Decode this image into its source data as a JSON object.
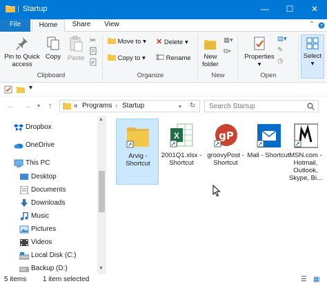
{
  "window": {
    "title": "Startup",
    "minimize_glyph": "—",
    "maximize_glyph": "☐",
    "close_glyph": "✕"
  },
  "tabs": [
    {
      "label": "File"
    },
    {
      "label": "Home"
    },
    {
      "label": "Share"
    },
    {
      "label": "View"
    }
  ],
  "ribbon": {
    "clipboard": {
      "pin_label": "Pin to Quick access",
      "copy_label": "Copy",
      "paste_label": "Paste",
      "group_label": "Clipboard"
    },
    "organize": {
      "move_to_label": "Move to",
      "copy_to_label": "Copy to",
      "delete_label": "Delete",
      "rename_label": "Rename",
      "group_label": "Organize"
    },
    "new": {
      "new_folder_label": "New folder",
      "group_label": "New"
    },
    "open": {
      "properties_label": "Properties",
      "group_label": "Open"
    },
    "select": {
      "select_label": "Select"
    }
  },
  "address": {
    "chevron": "«",
    "crumbs": [
      "Programs",
      "Startup"
    ],
    "search_placeholder": "Search Startup"
  },
  "nav": {
    "items": [
      {
        "label": "Dropbox",
        "icon": "dropbox-icon"
      },
      {
        "label": "OneDrive",
        "icon": "onedrive-icon"
      },
      {
        "label": "This PC",
        "icon": "computer-icon"
      },
      {
        "label": "Desktop",
        "icon": "desktop-icon"
      },
      {
        "label": "Documents",
        "icon": "documents-icon"
      },
      {
        "label": "Downloads",
        "icon": "downloads-icon"
      },
      {
        "label": "Music",
        "icon": "music-icon"
      },
      {
        "label": "Pictures",
        "icon": "pictures-icon"
      },
      {
        "label": "Videos",
        "icon": "videos-icon"
      },
      {
        "label": "Local Disk (C:)",
        "icon": "drive-icon"
      },
      {
        "label": "Backup (D:)",
        "icon": "drive-icon"
      }
    ]
  },
  "files": [
    {
      "label": "Arvig - Shortcut",
      "icon": "folder-icon",
      "selected": true
    },
    {
      "label": "2001Q1.xlsx - Shortcut",
      "icon": "excel-icon",
      "selected": false
    },
    {
      "label": "groovyPost - Shortcut",
      "icon": "groovypost-icon",
      "selected": false
    },
    {
      "label": "Mail - Shortcut",
      "icon": "mail-icon",
      "selected": false
    },
    {
      "label": "MSN.com - Hotmail, Outlook, Skype, Bi...",
      "icon": "msn-icon",
      "selected": false
    }
  ],
  "status": {
    "count": "5 items",
    "selection": "1 item selected"
  },
  "colors": {
    "titlebar": "#0078d7",
    "selection_bg": "#cce8ff",
    "folder": "#f1c84b"
  }
}
